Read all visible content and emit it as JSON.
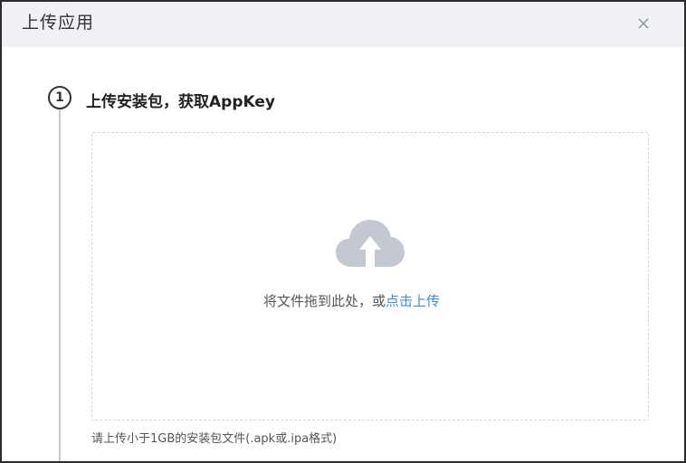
{
  "dialog": {
    "title": "上传应用",
    "close_icon": "close-icon"
  },
  "step": {
    "number": "1",
    "title": "上传安装包，获取AppKey"
  },
  "upload": {
    "icon": "cloud-upload-icon",
    "text_prefix": "将文件拖到此处，或",
    "link_text": "点击上传",
    "link_color": "#3a8ee6",
    "hint": "请上传小于1GB的安装包文件(.apk或.ipa格式)"
  }
}
